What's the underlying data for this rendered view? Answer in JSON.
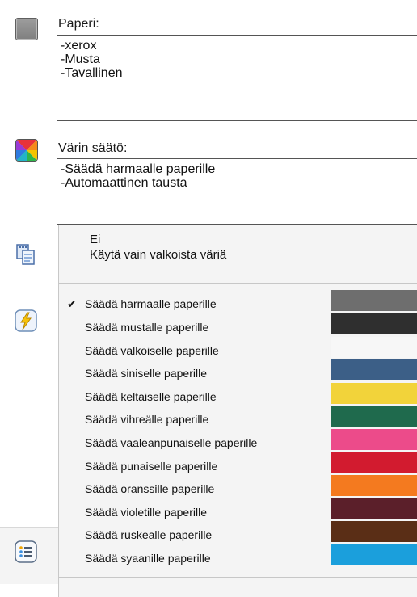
{
  "paper": {
    "label": "Paperi:",
    "lines": [
      "-xerox",
      "-Musta",
      "-Tavallinen"
    ]
  },
  "color_adjust": {
    "label": "Värin säätö:",
    "lines": [
      "-Säädä harmaalle paperille",
      "-Automaattinen tausta"
    ]
  },
  "dropdown": {
    "upper_items": [
      "Ei",
      "Käytä vain valkoista väriä"
    ],
    "check_mark": "✔",
    "items": [
      {
        "label": "Säädä harmaalle paperille",
        "checked": true,
        "swatch": "#6e6e6e"
      },
      {
        "label": "Säädä mustalle paperille",
        "checked": false,
        "swatch": "#2f2f2f"
      },
      {
        "label": "Säädä valkoiselle paperille",
        "checked": false,
        "swatch": "#f7f7f7"
      },
      {
        "label": "Säädä siniselle paperille",
        "checked": false,
        "swatch": "#3c5f87"
      },
      {
        "label": "Säädä keltaiselle paperille",
        "checked": false,
        "swatch": "#f2d33a"
      },
      {
        "label": "Säädä vihreälle paperille",
        "checked": false,
        "swatch": "#1f6a4d"
      },
      {
        "label": "Säädä vaaleanpunaiselle paperille",
        "checked": false,
        "swatch": "#ec4b8a"
      },
      {
        "label": "Säädä punaiselle paperille",
        "checked": false,
        "swatch": "#d21b2f"
      },
      {
        "label": "Säädä oranssille paperille",
        "checked": false,
        "swatch": "#f47a1f"
      },
      {
        "label": "Säädä violetille paperille",
        "checked": false,
        "swatch": "#5b1f2a"
      },
      {
        "label": "Säädä ruskealle paperille",
        "checked": false,
        "swatch": "#5a2e16"
      },
      {
        "label": "Säädä syaanille paperille",
        "checked": false,
        "swatch": "#1b9fdc"
      }
    ]
  },
  "icons": {
    "paper": "paper-icon",
    "color": "color-adjust-icon",
    "copy": "copy-icon",
    "bolt": "lightning-icon",
    "list": "list-icon"
  }
}
